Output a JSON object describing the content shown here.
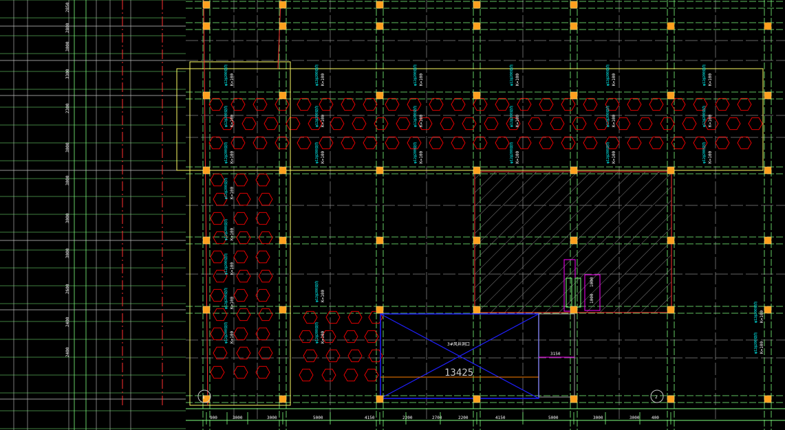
{
  "drawing": {
    "annotations": {
      "opening_label": "3#风井洞口",
      "opening_dimension": "13425",
      "small_dim": "3150",
      "small_hatch_dims": [
        "1000",
        "1000"
      ]
    },
    "bottom_dimensions": [
      "900",
      "3000",
      "3000",
      "5000",
      "4150",
      "2200",
      "2700",
      "2200",
      "4150",
      "5000",
      "3000",
      "3000",
      "400"
    ],
    "left_dimensions": [
      "2850",
      "2800",
      "3000",
      "3300",
      "2300",
      "3000",
      "3000",
      "3000",
      "3000",
      "2600",
      "2400",
      "2400"
    ],
    "cyan_note": "φ12@200双向",
    "white_note": "K=100",
    "axis_circles": [
      "1",
      "2"
    ],
    "colors": {
      "background": "#000000",
      "grid_green": "#7fff7f",
      "grid_white": "#c8c8c8",
      "column_orange": "#ffa01e",
      "hexagon_red": "#ff0000",
      "outline_yellow": "#ffff66",
      "opening_blue": "#0000ff",
      "dimension_orange": "#ff7f00",
      "hatch_grey": "#808080",
      "magenta": "#ff00ff",
      "cyan_text": "#00ffff"
    }
  }
}
